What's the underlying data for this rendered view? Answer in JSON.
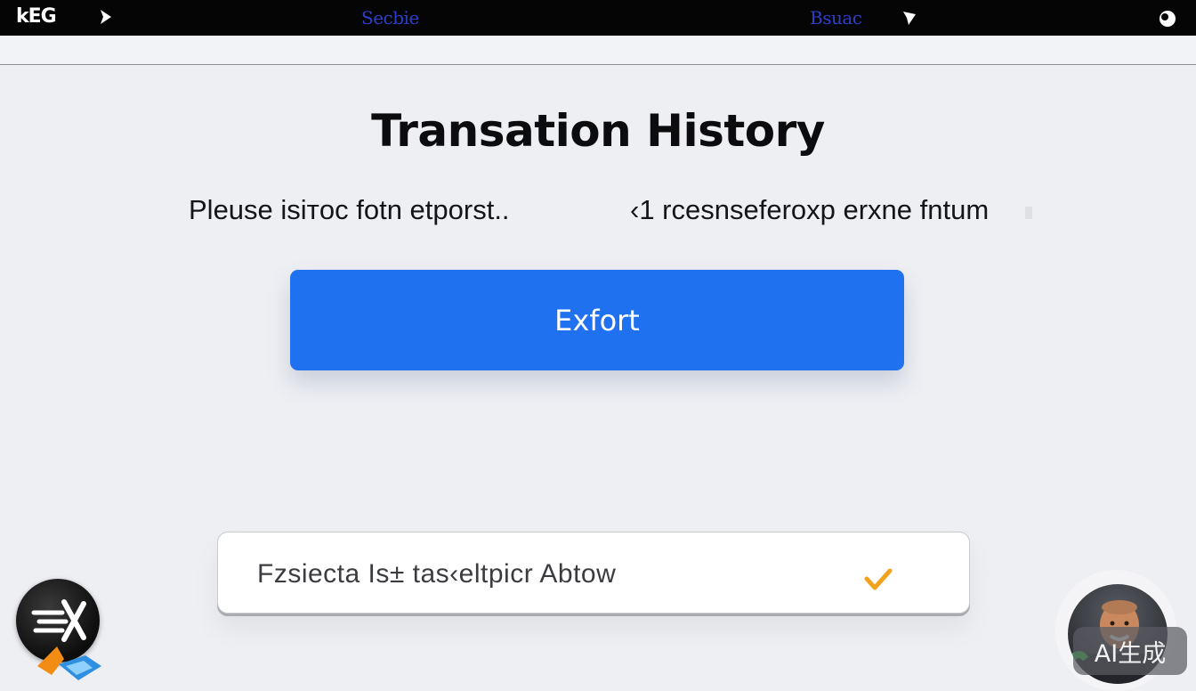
{
  "topbar": {
    "logo_text": "kEG",
    "nav_1": "Secbie",
    "nav_2": "Bsuac"
  },
  "page": {
    "title": "Transation History",
    "instruction_left": "Pleuse isiтoc fotn etporst..",
    "instruction_right": "‹1  rcesnseferoxp erxne fntum"
  },
  "export_button": {
    "label": "Exfort",
    "color": "#1f71ef"
  },
  "format_select": {
    "value": "Fzsiecta  Is± tas‹eltpicr   Abtow"
  },
  "watermark": {
    "text": "AI生成"
  },
  "icons": {
    "forward_1": "chevron-right-icon",
    "forward_2": "chevron-right-icon",
    "search": "search-icon",
    "check": "checkmark-icon",
    "logo": "brand-logo-icon",
    "avatar": "assistant-avatar"
  }
}
